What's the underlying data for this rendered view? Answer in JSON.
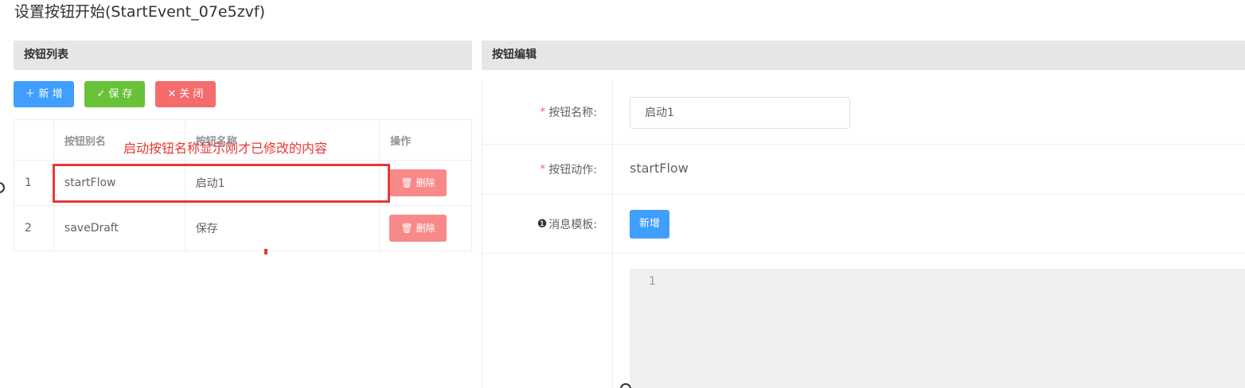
{
  "dialog": {
    "title": "设置按钮开始(StartEvent_07e5zvf)"
  },
  "left_panel": {
    "header": "按钮列表",
    "toolbar": {
      "add_label": "新 增",
      "save_label": "保 存",
      "close_label": "关 闭"
    },
    "table": {
      "columns": [
        "",
        "按钮别名",
        "按钮名称",
        "操作"
      ],
      "rows": [
        {
          "index": "1",
          "alias": "startFlow",
          "name": "启动1",
          "action_label": "删除"
        },
        {
          "index": "2",
          "alias": "saveDraft",
          "name": "保存",
          "action_label": "删除"
        }
      ]
    },
    "annotation": "启动按钮名称显示刚才已修改的内容"
  },
  "right_panel": {
    "header": "按钮编辑",
    "fields": {
      "name_label": "按钮名称:",
      "name_value": "启动1",
      "action_label": "按钮动作:",
      "action_value": "startFlow",
      "template_label": "消息模板:",
      "template_add_label": "新增"
    },
    "editor": {
      "line_number": "1"
    }
  },
  "colors": {
    "primary": "#409eff",
    "success": "#67c23a",
    "danger": "#f56c6c",
    "annotation": "#e53935"
  }
}
